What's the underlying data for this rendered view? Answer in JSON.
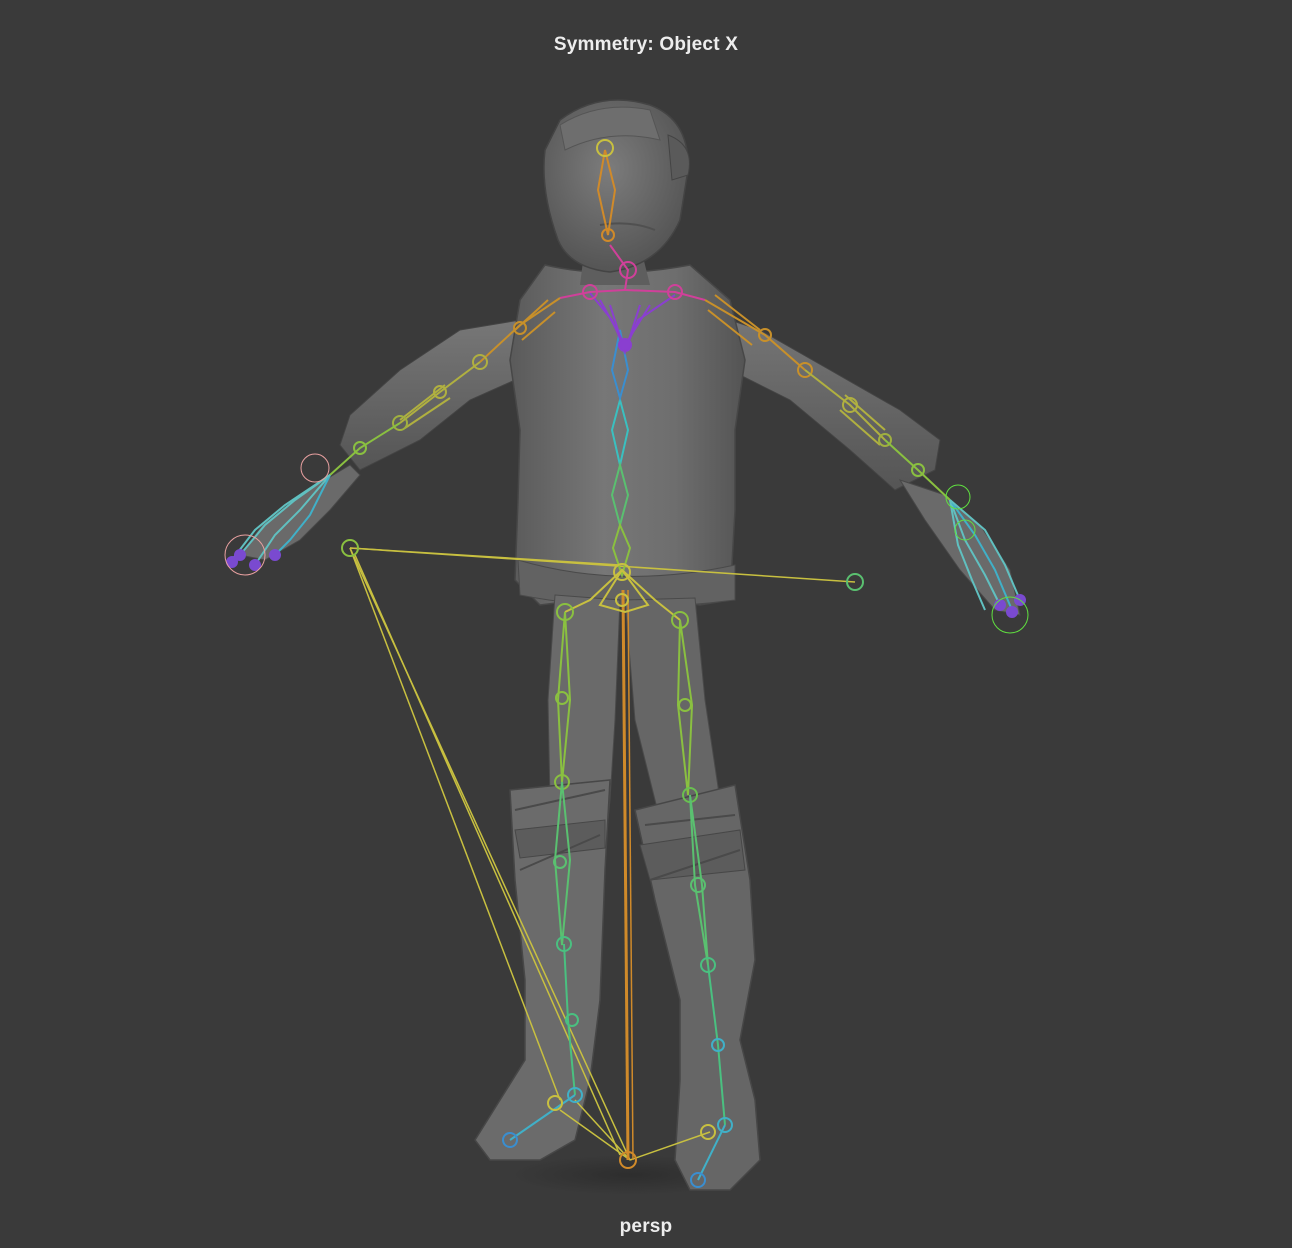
{
  "viewport": {
    "symmetry_label": "Symmetry: Object X",
    "camera_label": "persp",
    "background_color": "#3a3a3a"
  },
  "scene": {
    "model": "character-mesh",
    "mesh_color": "#6c6c6c",
    "skeleton_colors": {
      "head": "#d08a2a",
      "neck": "#d0409a",
      "clavicle": "#c04ab0",
      "spine_upper": "#8a3fd0",
      "spine_mid": "#3a8ed0",
      "spine_low": "#3ac0c0",
      "spine_base": "#5ac070",
      "arm_upper": "#c8902a",
      "arm_lower": "#b0b040",
      "hand": "#60c0c0",
      "fingers": "#7a4ad0",
      "leg": "#8ac040",
      "leg_lower": "#4ac080",
      "foot": "#40b0c8",
      "ik": "#c8c040",
      "root": "#d08a2a"
    }
  }
}
